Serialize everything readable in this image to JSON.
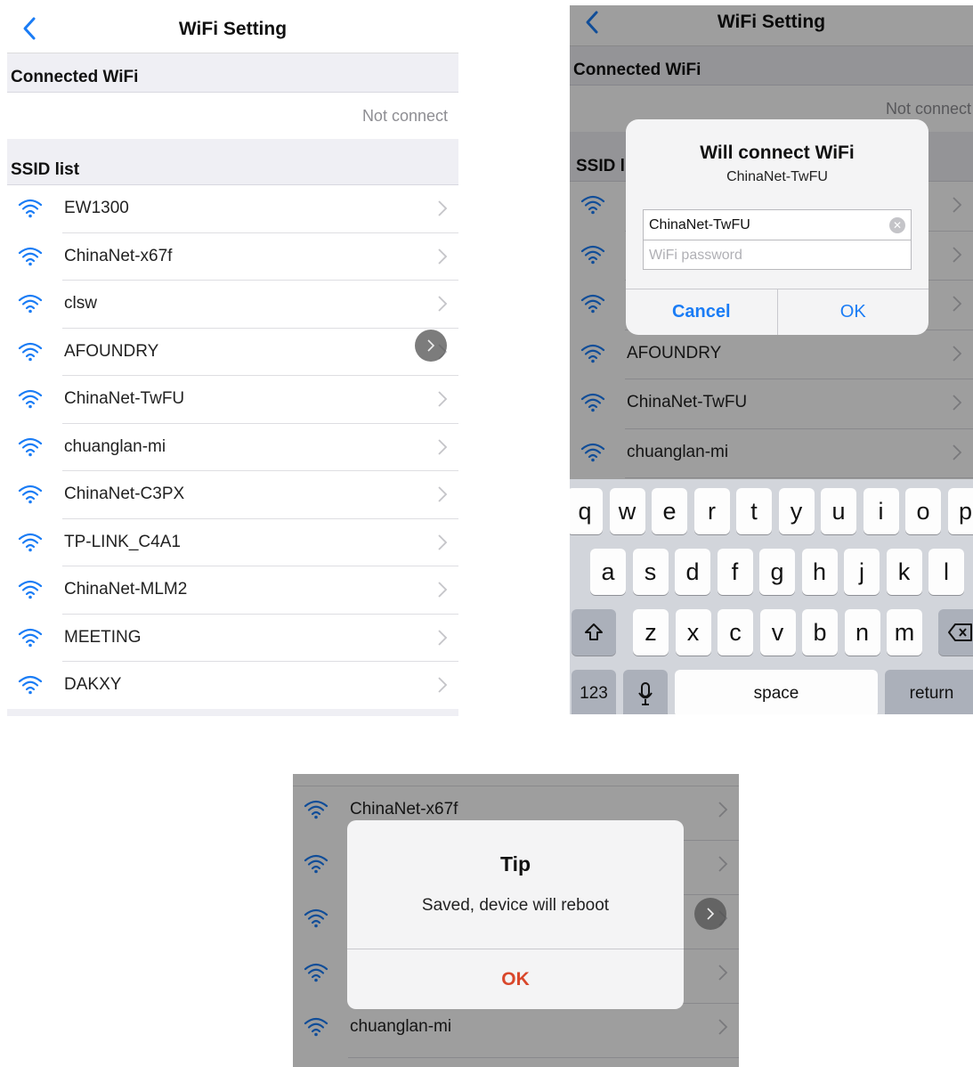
{
  "colors": {
    "accent": "#1a7cf5",
    "tip_ok": "#d9472b",
    "group_bg": "#efeff4"
  },
  "screen1": {
    "title": "WiFi Setting",
    "connected_header": "Connected WiFi",
    "connected_status": "Not connect",
    "ssid_header": "SSID list",
    "networks": [
      "EW1300",
      "ChinaNet-x67f",
      "clsw",
      "AFOUNDRY",
      "ChinaNet-TwFU",
      "chuanglan-mi",
      "ChinaNet-C3PX",
      "TP-LINK_C4A1",
      "ChinaNet-MLM2",
      "MEETING",
      "DAKXY"
    ]
  },
  "screen2": {
    "title": "WiFi Setting",
    "connected_header": "Connected WiFi",
    "connected_status": "Not connect",
    "ssid_header": "SSID l",
    "networks": [
      "",
      "",
      "",
      "AFOUNDRY",
      "ChinaNet-TwFU",
      "chuanglan-mi"
    ],
    "dialog": {
      "title": "Will connect WiFi",
      "subtitle": "ChinaNet-TwFU",
      "ssid_value": "ChinaNet-TwFU",
      "password_placeholder": "WiFi password",
      "cancel_label": "Cancel",
      "ok_label": "OK"
    },
    "keyboard": {
      "row1": [
        "q",
        "w",
        "e",
        "r",
        "t",
        "y",
        "u",
        "i",
        "o",
        "p"
      ],
      "row2": [
        "a",
        "s",
        "d",
        "f",
        "g",
        "h",
        "j",
        "k",
        "l"
      ],
      "row3": [
        "z",
        "x",
        "c",
        "v",
        "b",
        "n",
        "m"
      ],
      "numbers_label": "123",
      "space_label": "space",
      "return_label": "return"
    }
  },
  "screen3": {
    "networks": [
      "ChinaNet-x67f",
      "",
      "",
      "",
      "chuanglan-mi"
    ],
    "tip": {
      "title": "Tip",
      "message": "Saved, device will reboot",
      "ok_label": "OK"
    }
  }
}
